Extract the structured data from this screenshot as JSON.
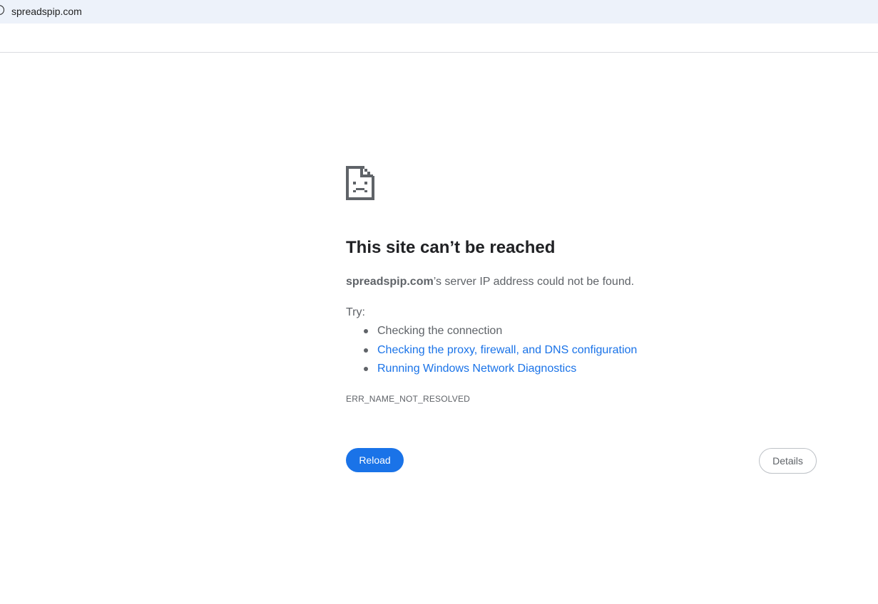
{
  "browser": {
    "url": "spreadspip.com"
  },
  "error_page": {
    "icon": "sad-page-icon",
    "title": "This site can’t be reached",
    "summary_host": "spreadspip.com",
    "summary_rest": "’s server IP address could not be found.",
    "try_label": "Try:",
    "suggestions": [
      {
        "label": "Checking the connection",
        "is_link": false
      },
      {
        "label": "Checking the proxy, firewall, and DNS configuration",
        "is_link": true
      },
      {
        "label": "Running Windows Network Diagnostics",
        "is_link": true
      }
    ],
    "error_code": "ERR_NAME_NOT_RESOLVED",
    "reload_label": "Reload",
    "details_label": "Details"
  },
  "colors": {
    "accent": "#1a73e8",
    "text": "#5f6368",
    "title": "#202124",
    "address_bar_bg": "#edf2fa"
  }
}
